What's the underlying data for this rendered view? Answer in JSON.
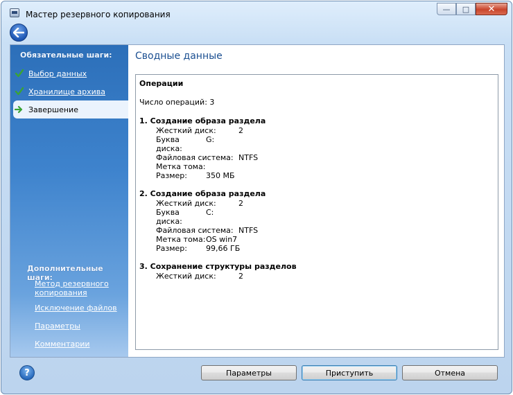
{
  "window": {
    "title": "Мастер резервного копирования"
  },
  "caption": {
    "minimize": "—",
    "maximize": "□",
    "close": "✕"
  },
  "sidebar": {
    "required_title": "Обязательные шаги:",
    "required_steps": [
      {
        "label": "Выбор данных",
        "state": "done",
        "icon": "check-icon"
      },
      {
        "label": "Хранилище архива",
        "state": "done",
        "icon": "check-icon"
      },
      {
        "label": "Завершение",
        "state": "current",
        "icon": "arrow-icon"
      }
    ],
    "optional_title": "Дополнительные шаги:",
    "optional_steps": [
      {
        "label": "Метод резервного копирования"
      },
      {
        "label": "Исключение файлов"
      },
      {
        "label": "Параметры"
      },
      {
        "label": "Комментарии"
      }
    ]
  },
  "main": {
    "title": "Сводные данные",
    "summary": {
      "header": "Операции",
      "count_text": "Число операций: 3",
      "operations": [
        {
          "title": "1. Создание образа раздела",
          "fields": [
            {
              "key": "Жесткий диск:",
              "value": "2"
            },
            {
              "key": "Буква диска:",
              "value": "G:"
            },
            {
              "key": "Файловая система:",
              "value": "NTFS"
            },
            {
              "key": "Метка тома:",
              "value": ""
            },
            {
              "key": "Размер:",
              "value": "350 МБ"
            }
          ]
        },
        {
          "title": "2. Создание образа раздела",
          "fields": [
            {
              "key": "Жесткий диск:",
              "value": "2"
            },
            {
              "key": "Буква диска:",
              "value": "C:"
            },
            {
              "key": "Файловая система:",
              "value": "NTFS"
            },
            {
              "key": "Метка тома:",
              "value": "OS win7"
            },
            {
              "key": "Размер:",
              "value": "99,66 ГБ"
            }
          ]
        },
        {
          "title": "3. Сохранение структуры разделов",
          "fields": [
            {
              "key": "Жесткий диск:",
              "value": "2"
            }
          ]
        }
      ]
    }
  },
  "footer": {
    "help_label": "?",
    "params_button": "Параметры",
    "proceed_button": "Приступить",
    "cancel_button": "Отмена"
  },
  "colors": {
    "accent": "#1b4f91",
    "sidebar_top": "#2c6fb9",
    "sidebar_bottom": "#a7c9ee",
    "check_green": "#3aa335"
  }
}
